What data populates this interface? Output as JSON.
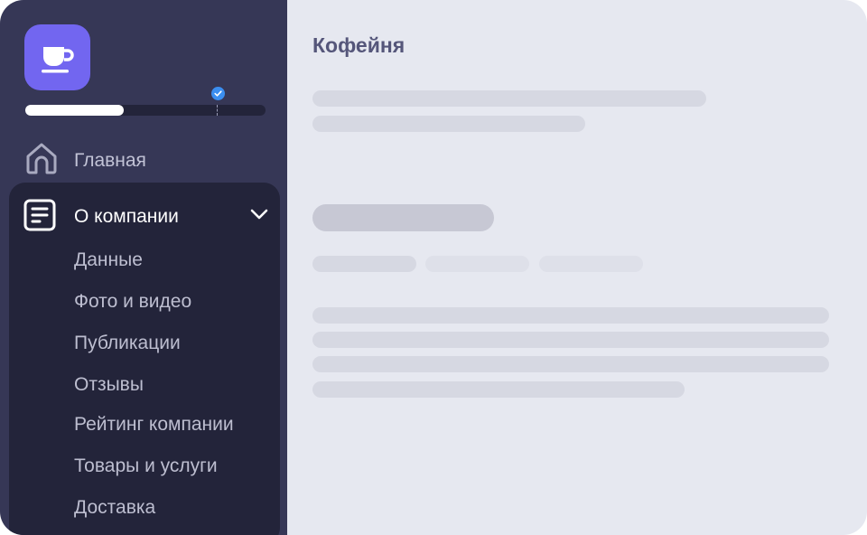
{
  "content": {
    "title": "Кофейня"
  },
  "sidebar": {
    "logo_icon": "coffee-cup-icon",
    "logo_color": "#7266f0",
    "progress": {
      "value_fraction": 0.41,
      "milestone_fraction": 0.8,
      "milestone_icon": "checkmark-icon",
      "milestone_color": "#3b8ef0"
    },
    "home": {
      "icon": "home-icon",
      "label": "Главная"
    },
    "company": {
      "icon": "document-icon",
      "label": "О компании",
      "expanded": true,
      "chevron_icon": "chevron-down-icon",
      "items": [
        {
          "label": "Данные"
        },
        {
          "label": "Фото и видео"
        },
        {
          "label": "Публикации"
        },
        {
          "label": "Отзывы"
        },
        {
          "label": "Рейтинг компании"
        },
        {
          "label": "Товары и услуги"
        },
        {
          "label": "Доставка"
        }
      ]
    }
  },
  "colors": {
    "sidebar_bg": "#363756",
    "submenu_bg": "#23243a",
    "content_bg": "#e6e8f0"
  }
}
